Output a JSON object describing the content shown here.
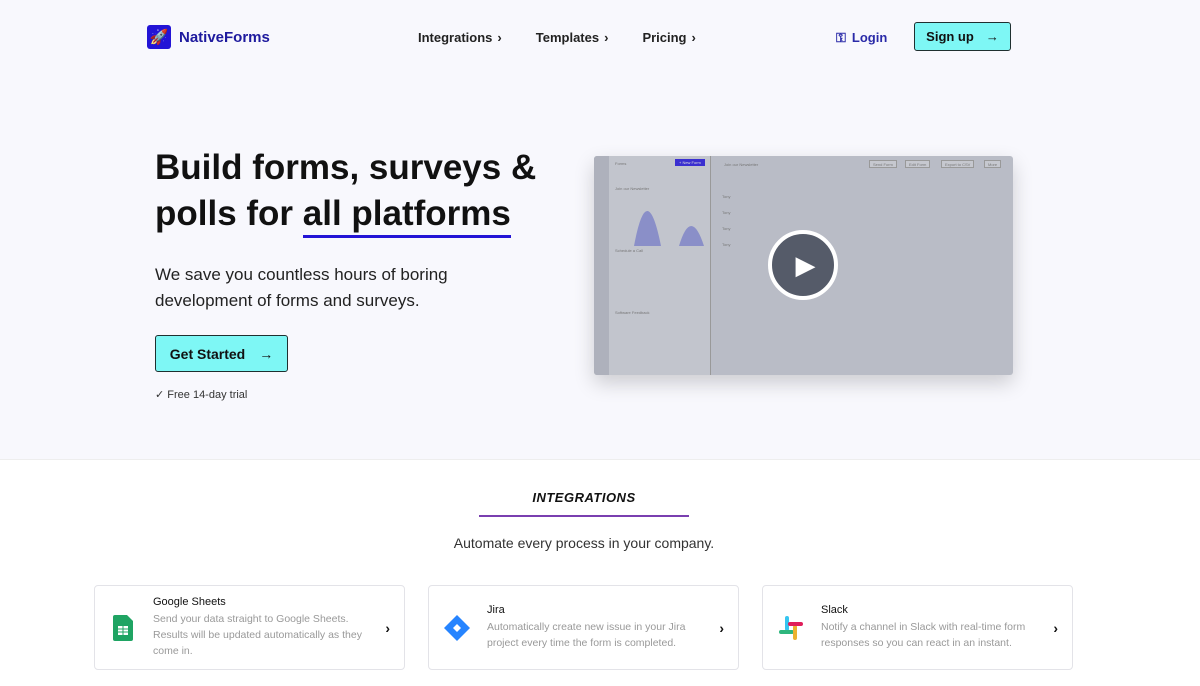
{
  "header": {
    "brand": "NativeForms",
    "nav": [
      {
        "label": "Integrations"
      },
      {
        "label": "Templates"
      },
      {
        "label": "Pricing"
      }
    ],
    "login": "Login",
    "signup": "Sign up"
  },
  "hero": {
    "title_pre": "Build forms, surveys & polls for ",
    "title_highlight": "all platforms",
    "subtitle": "We save you countless hours of boring development of forms and surveys.",
    "cta": "Get Started",
    "trial": "✓ Free 14-day trial"
  },
  "video": {
    "forms_label": "Forms",
    "new_form": "+ New Form",
    "forms": [
      "Join our Newsletter",
      "Schedule a Call",
      "Software Feedback"
    ],
    "current_form": "Join our Newsletter",
    "actions": [
      "Send Form",
      "Edit Form",
      "Export to CSV",
      "More"
    ],
    "rows": [
      "Tony",
      "Tony",
      "Tony",
      "Tony"
    ]
  },
  "integrations": {
    "title": "INTEGRATIONS",
    "subtitle": "Automate every process in your company.",
    "cards": [
      {
        "name": "Google Sheets",
        "desc": "Send your data straight to Google Sheets. Results will be updated automatically as they come in."
      },
      {
        "name": "Jira",
        "desc": "Automatically create new issue in your Jira project every time the form is completed."
      },
      {
        "name": "Slack",
        "desc": "Notify a channel in Slack with real-time form responses so you can react in an instant."
      }
    ]
  },
  "colors": {
    "accent": "#2314d6",
    "cta": "#7ef7f5",
    "divider": "#7a3fb0"
  }
}
